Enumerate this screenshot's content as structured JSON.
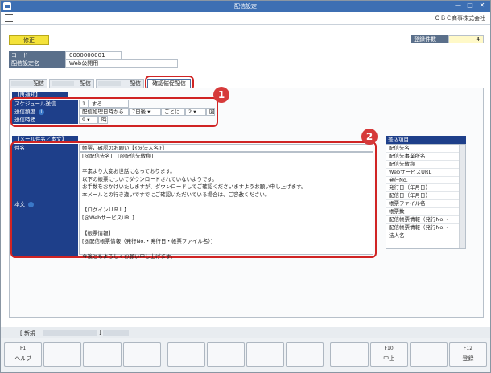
{
  "window": {
    "title": "配信設定",
    "company": "ＯＢＣ商事株式会社",
    "min": "—",
    "max": "□",
    "close": "✕"
  },
  "mode_label": "修正",
  "count": {
    "label": "登録件数",
    "value": "4"
  },
  "code": {
    "label": "コード",
    "value": "0000000001"
  },
  "setting_name": {
    "label": "配信設定名",
    "value": "Web公開用"
  },
  "tabs": [
    {
      "label": "配信"
    },
    {
      "label": "配信"
    },
    {
      "label": "配信"
    },
    {
      "label": "確認催促配信"
    }
  ],
  "reminder": {
    "header": "【再通知】",
    "schedule_label": "スケジュール送信",
    "schedule_num": "1",
    "schedule_val": "する",
    "freq_label": "送信頻度",
    "freq_base": "配信処理日時から",
    "freq_days": "7日後",
    "freq_every": "ごとに",
    "freq_count": "2",
    "freq_unit": "回",
    "time_label": "送信時間",
    "time_hour": "9",
    "time_unit": "時"
  },
  "mail": {
    "header": "【メール件名／本文】",
    "subject_label": "件名",
    "subject": "帳票ご確認のお願い【{@法人名}】",
    "body_label": "本文",
    "body_lines": [
      "[@配信先名]　[@配信先敬称]",
      "",
      "平素より大変お世話になっております。",
      "以下の帳票についてダウンロードされていないようです。",
      "お手数をおかけいたしますが、ダウンロードしてご確認くださいますようお願い申し上げます。",
      "本メールとの行き違いですでにご確認いただいている場合は、ご容赦ください。",
      "",
      "【ログインＵＲＬ】",
      "[@WebサービスURL]",
      "",
      "【帳票情報】",
      "[@配信帳票情報（発行No.・発行日・帳票ファイル名）]",
      "",
      "今後ともよろしくお願い申し上げます。"
    ]
  },
  "insert_items": {
    "header": "差込項目",
    "items": [
      "配信先名",
      "配信先事業所名",
      "配信先敬称",
      "WebサービスURL",
      "発行No.",
      "発行日（年月日）",
      "配信日（年月日）",
      "帳票ファイル名",
      "帳票数",
      "配信帳票情報（発行No.・",
      "配信帳票情報（発行No.・",
      "法人名"
    ]
  },
  "callouts": [
    "1",
    "2"
  ],
  "status": {
    "new_label": "[ 新規",
    "close_bracket": "]"
  },
  "fkeys": [
    {
      "num": "F1",
      "label": "ヘルプ"
    },
    {
      "num": "",
      "label": ""
    },
    {
      "num": "",
      "label": ""
    },
    {
      "num": "",
      "label": ""
    },
    {
      "num": "",
      "label": ""
    },
    {
      "num": "",
      "label": ""
    },
    {
      "num": "",
      "label": ""
    },
    {
      "num": "",
      "label": ""
    },
    {
      "num": "F10",
      "label": "中止"
    },
    {
      "num": "",
      "label": ""
    },
    {
      "num": "",
      "label": ""
    },
    {
      "num": "F12",
      "label": "登録"
    }
  ]
}
